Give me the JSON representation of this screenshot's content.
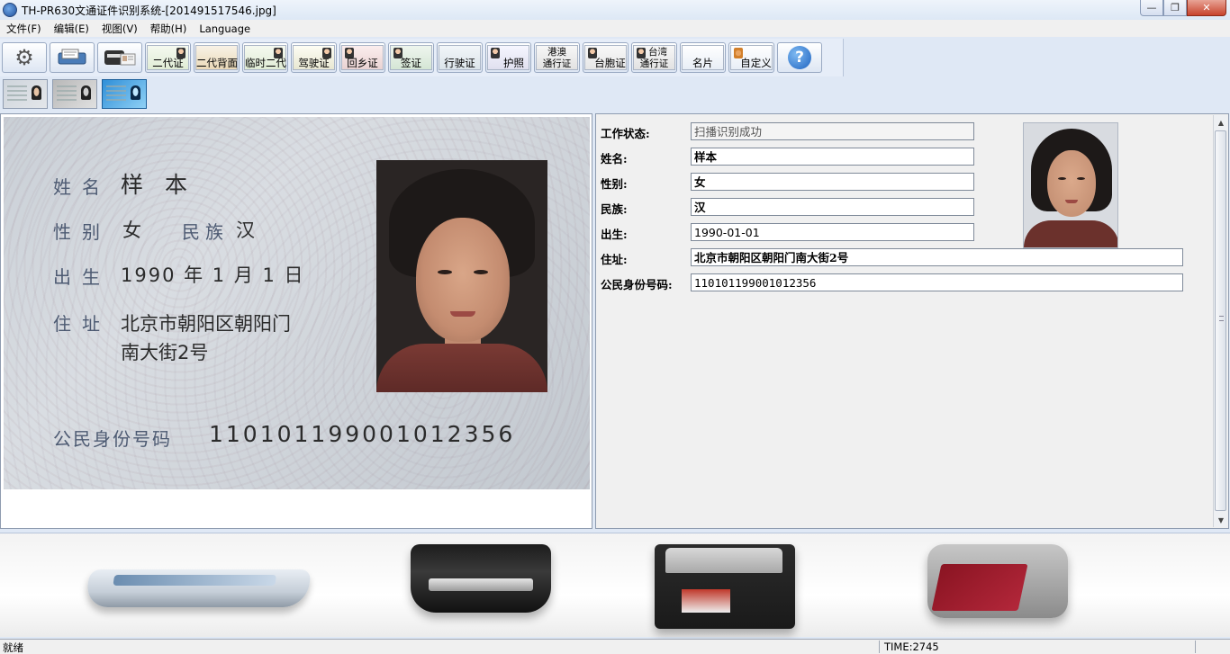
{
  "window": {
    "title": "TH-PR630文通证件识别系统-[201491517546.jpg]",
    "controls": [
      "minimize",
      "maximize",
      "close"
    ]
  },
  "menu": [
    "文件(F)",
    "编辑(E)",
    "视图(V)",
    "帮助(H)",
    "Language"
  ],
  "toolbar": {
    "settings_icon": "gear-icon",
    "scan_icon": "scanner-icon",
    "device_icon": "card-reader-icon",
    "documents": [
      {
        "label": "二代证",
        "top": ""
      },
      {
        "label": "二代背面",
        "top": ""
      },
      {
        "label": "临时二代",
        "top": ""
      },
      {
        "label": "驾驶证",
        "top": ""
      },
      {
        "label": "回乡证",
        "top": ""
      },
      {
        "label": "签证",
        "top": ""
      },
      {
        "label": "行驶证",
        "top": ""
      },
      {
        "label": "护照",
        "top": ""
      },
      {
        "label": "通行证",
        "top": "港澳"
      },
      {
        "label": "台胞证",
        "top": ""
      },
      {
        "label": "通行证",
        "top": "台湾"
      },
      {
        "label": "名片",
        "top": ""
      },
      {
        "label": "自定义",
        "top": ""
      }
    ],
    "help_icon": "help-icon"
  },
  "thumbnails": [
    "thumb-1",
    "thumb-2",
    "thumb-3"
  ],
  "id_card_image": {
    "name_label": "姓名",
    "name": "样 本",
    "gender_label": "性别",
    "gender": "女",
    "ethnicity_label": "民族",
    "ethnicity": "汉",
    "birth_label": "出生",
    "birth": "1990 年 1 月 1 日",
    "address_label": "住址",
    "address_line1": "北京市朝阳区朝阳门",
    "address_line2": "南大街2号",
    "id_label": "公民身份号码",
    "id_number": "110101199001012356"
  },
  "result": {
    "status_label": "工作状态:",
    "status_value": "扫播识别成功",
    "name_label": "姓名:",
    "name_value": "样本",
    "gender_label": "性别:",
    "gender_value": "女",
    "ethnicity_label": "民族:",
    "ethnicity_value": "汉",
    "birth_label": "出生:",
    "birth_value": "1990-01-01",
    "address_label": "住址:",
    "address_value": "北京市朝阳区朝阳门南大街2号",
    "id_label": "公民身份号码:",
    "id_value": "110101199001012356"
  },
  "devices": [
    "flatbed-scanner",
    "card-scanner",
    "document-scanner",
    "passport-reader"
  ],
  "statusbar": {
    "left": "就绪",
    "right": "TIME:2745"
  }
}
